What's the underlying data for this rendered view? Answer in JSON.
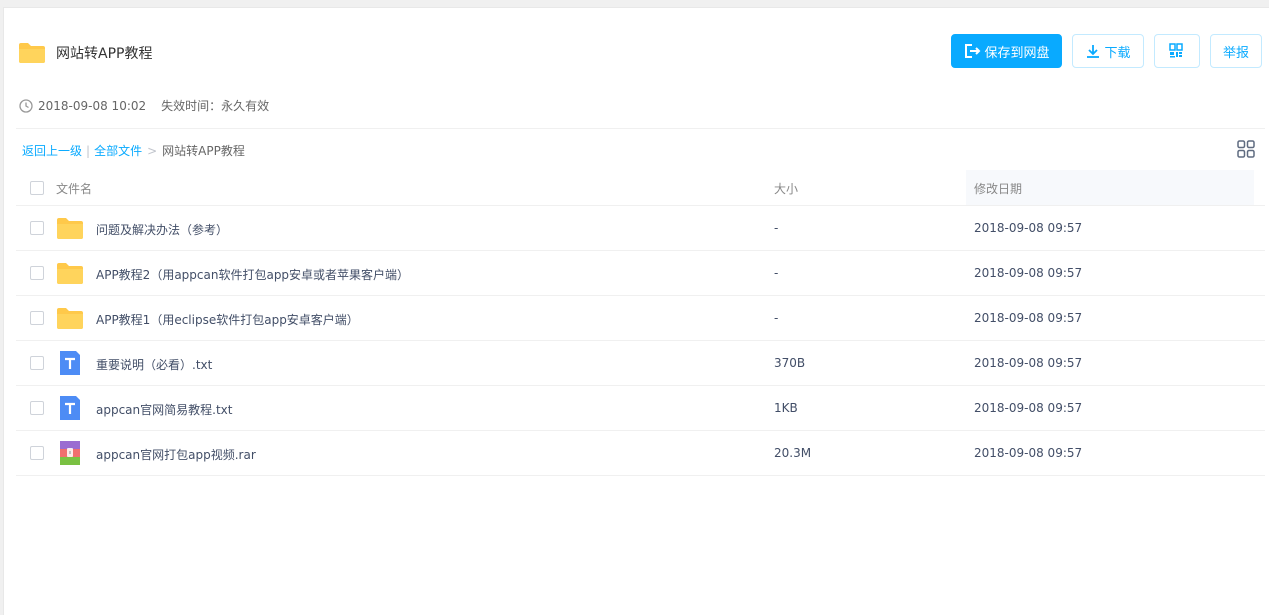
{
  "share": {
    "title": "网站转APP教程",
    "created": "2018-09-08 10:02",
    "expire": "失效时间：永久有效"
  },
  "actions": {
    "save_label": "保存到网盘",
    "download_label": "下载",
    "report_label": "举报"
  },
  "breadcrumb": {
    "back": "返回上一级",
    "sep_pipe": "|",
    "all": "全部文件",
    "sep_arrow": ">",
    "current": "网站转APP教程"
  },
  "table": {
    "columns": {
      "name": "文件名",
      "size": "大小",
      "date": "修改日期"
    },
    "rows": [
      {
        "type": "folder",
        "name": "问题及解决办法（参考）",
        "size": "-",
        "date": "2018-09-08 09:57"
      },
      {
        "type": "folder",
        "name": "APP教程2（用appcan软件打包app安卓或者苹果客户端）",
        "size": "-",
        "date": "2018-09-08 09:57"
      },
      {
        "type": "folder",
        "name": "APP教程1（用eclipse软件打包app安卓客户端）",
        "size": "-",
        "date": "2018-09-08 09:57"
      },
      {
        "type": "txt",
        "name": "重要说明（必看）.txt",
        "size": "370B",
        "date": "2018-09-08 09:57"
      },
      {
        "type": "txt",
        "name": "appcan官网简易教程.txt",
        "size": "1KB",
        "date": "2018-09-08 09:57"
      },
      {
        "type": "rar",
        "name": "appcan官网打包app视频.rar",
        "size": "20.3M",
        "date": "2018-09-08 09:57"
      }
    ]
  },
  "colors": {
    "accent": "#09aaff",
    "folder": "#ffc94a",
    "txt": "#4d8cf5"
  }
}
